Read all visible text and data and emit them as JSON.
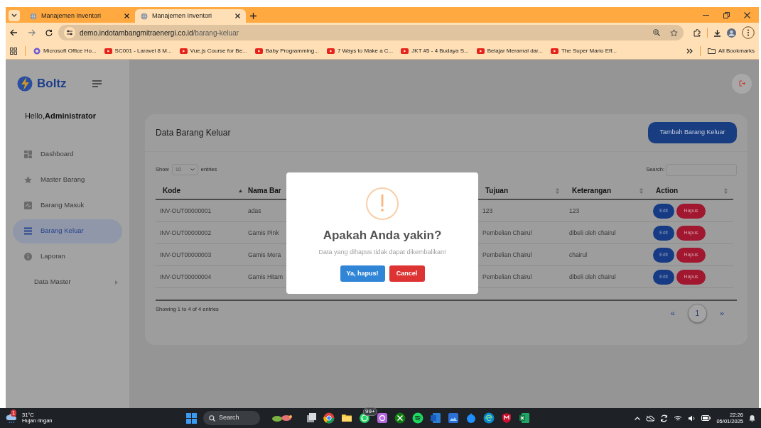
{
  "browser": {
    "tabs": [
      {
        "title": "Manajemen Inventori",
        "selected": false
      },
      {
        "title": "Manajemen Inventori",
        "selected": true
      }
    ],
    "address": {
      "host": "demo.indotambangmitraenergi.co.id",
      "path": "/barang-keluar"
    },
    "bookmarks": [
      {
        "label": "Microsoft Office Ho...",
        "kind": "office"
      },
      {
        "label": "SC001 - Laravel 8 M...",
        "kind": "video"
      },
      {
        "label": "Vue.js Course for Be...",
        "kind": "video"
      },
      {
        "label": "Baby Programming...",
        "kind": "video"
      },
      {
        "label": "7 Ways to Make a C...",
        "kind": "video"
      },
      {
        "label": "JKT #5 - 4 Budaya S...",
        "kind": "video"
      },
      {
        "label": "Belajar Meramal dar...",
        "kind": "video"
      },
      {
        "label": "The Super Mario Eff...",
        "kind": "video"
      }
    ],
    "all_bookmarks": "All Bookmarks"
  },
  "app": {
    "brand": "Boltz",
    "greeting": "Hello,**Administrator**",
    "sidebar": [
      {
        "label": "Dashboard",
        "selected": false,
        "kind": "link"
      },
      {
        "label": "Master Barang",
        "selected": false,
        "kind": "link"
      },
      {
        "label": "Barang Masuk",
        "selected": false,
        "kind": "link"
      },
      {
        "label": "Barang Keluar",
        "selected": true,
        "kind": "link"
      },
      {
        "label": "Laporan",
        "selected": false,
        "kind": "link"
      },
      {
        "label": "Data Master",
        "selected": false,
        "kind": "submenu"
      }
    ],
    "card": {
      "title": "Data Barang Keluar",
      "add_button": "Tambah Barang Keluar",
      "length_prefix": "Show",
      "length_value": "10",
      "length_suffix": "entries",
      "search_label": "Search:",
      "columns": [
        {
          "label": "Kode",
          "sortable": true,
          "sorted": true
        },
        {
          "label": "Nama Bar"
        },
        {
          "label": "Tujuan",
          "sortable": true,
          "sorted": false
        },
        {
          "label": "Keterangan",
          "sortable": true,
          "sorted": false
        },
        {
          "label": "Action",
          "sortable": true,
          "sorted": false
        }
      ],
      "rows": [
        {
          "cells": [
            "INV-OUT00000001",
            "adas",
            "123",
            "123"
          ],
          "actions": [
            "Edit",
            "Hapus"
          ]
        },
        {
          "cells": [
            "INV-OUT00000002",
            "Gamis Pink",
            "Pembelian Chairul",
            "dibeli oleh chairul"
          ],
          "actions": [
            "Edit",
            "Hapus"
          ]
        },
        {
          "cells": [
            "INV-OUT00000003",
            "Gamis Mera",
            "Pembelian Chairul",
            "chairul"
          ],
          "actions": [
            "Edit",
            "Hapus"
          ]
        },
        {
          "cells": [
            "INV-OUT00000004",
            "Gamis Hitam",
            "Pembelian Chairul",
            "dibeli oleh chairul"
          ],
          "actions": [
            "Edit",
            "Hapus"
          ]
        }
      ],
      "info": "Showing 1 to 4 of 4 entries",
      "pagination": {
        "prev": "«",
        "pages": [
          {
            "label": "1",
            "selected": true
          }
        ],
        "next": "»"
      }
    },
    "dialog": {
      "title": "Apakah Anda yakin?",
      "text": "Data yang dihapus tidak dapat dikembalikan!",
      "confirm": "Ya, hapus!",
      "cancel": "Cancel"
    }
  },
  "taskbar": {
    "weather": {
      "badge": "1",
      "temp": "31°C",
      "desc": "Hujan ringan"
    },
    "search": "Search",
    "app_badge": "99+",
    "time": "22:26",
    "date": "05/01/2025"
  }
}
